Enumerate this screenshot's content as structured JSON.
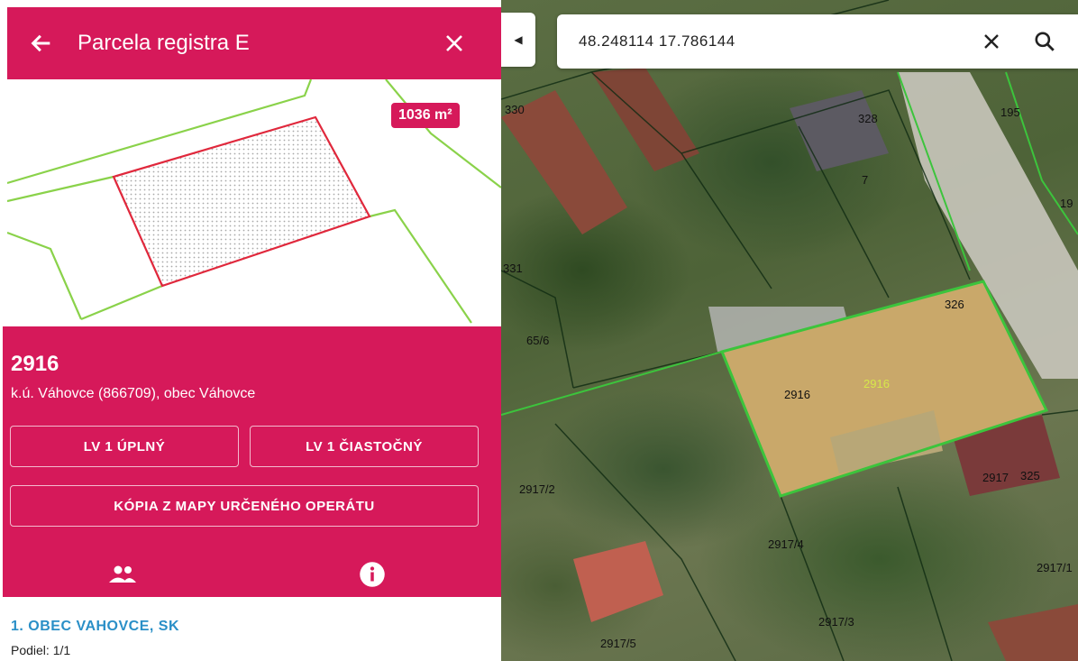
{
  "panel": {
    "title": "Parcela registra E",
    "area_badge": "1036 m²",
    "parcel_number": "2916",
    "location": "k.ú. Váhovce (866709), obec Váhovce",
    "buttons": {
      "lv_full": "LV 1 ÚPLNÝ",
      "lv_partial": "LV 1 ČIASTOČNÝ",
      "map_copy": "KÓPIA Z MAPY URČENÉHO OPERÁTU"
    },
    "tabs": [
      {
        "icon": "people-icon"
      },
      {
        "icon": "info-icon"
      }
    ],
    "owner": {
      "name": "1. OBEC VAHOVCE, SK",
      "share": "Podiel: 1/1"
    }
  },
  "search": {
    "value": "48.248114 17.786144"
  },
  "map": {
    "labels": [
      "330",
      "328",
      "195",
      "7",
      "331",
      "65/6",
      "326",
      "2916",
      "2916",
      "2917",
      "325",
      "2917/2",
      "2917/4",
      "2917/3",
      "2917/1",
      "2917/5",
      "19"
    ]
  },
  "colors": {
    "brand": "#d6195a",
    "selected_outline": "#3cc43c",
    "owner_link": "#2a8fc7"
  }
}
